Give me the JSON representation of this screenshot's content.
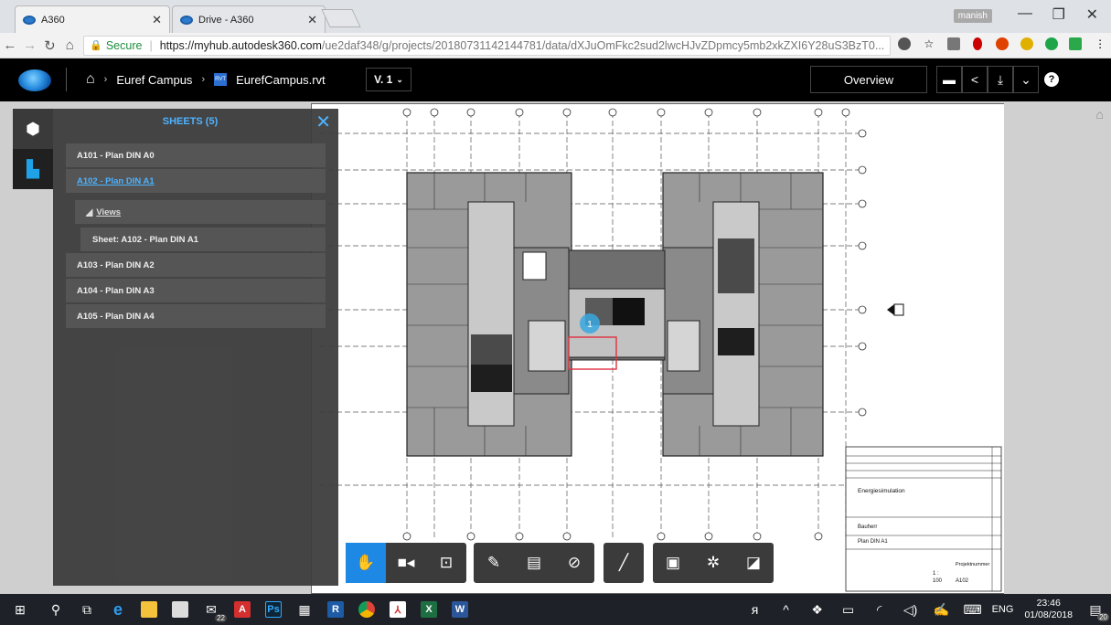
{
  "browser": {
    "tabs": [
      {
        "title": "A360",
        "active": true
      },
      {
        "title": "Drive - A360",
        "active": false
      }
    ],
    "user_badge": "manish",
    "address": {
      "secure_label": "Secure",
      "url_host": "https://myhub.autodesk360.com",
      "url_path": "/ue2daf348/g/projects/20180731142144781/data/dXJuOmFkc2sud2lwcHJvZDpmcy5mb2xkZXI6Y28uS3BzT0..."
    }
  },
  "app": {
    "breadcrumbs": [
      "Euref Campus",
      "EurefCampus.rvt"
    ],
    "version_label": "V. 1",
    "overview_label": "Overview"
  },
  "sheets_panel": {
    "title": "SHEETS (5)",
    "items": [
      {
        "label": "A101 - Plan DIN A0",
        "selected": false
      },
      {
        "label": "A102 - Plan DIN A1",
        "selected": true
      },
      {
        "label": "Views",
        "kind": "group"
      },
      {
        "label": "Sheet: A102 - Plan DIN A1",
        "kind": "sub"
      },
      {
        "label": "A103 - Plan DIN A2",
        "selected": false
      },
      {
        "label": "A104 - Plan DIN A3",
        "selected": false
      },
      {
        "label": "A105 - Plan DIN A4",
        "selected": false
      }
    ]
  },
  "drawing": {
    "marker_number": "1",
    "titleblock": {
      "project_name": "Energiesimulation",
      "client": "Bauherr",
      "sheet_name": "Plan DIN A1",
      "project_number": "Projektnummer",
      "scale": "100",
      "scale_prefix": "1 :",
      "sheet_number": "A102"
    }
  },
  "taskbar": {
    "badge_count": "22",
    "language": "ENG",
    "time": "23:46",
    "date": "01/08/2018",
    "notification_count": "20"
  },
  "icons": [
    "home-icon",
    "cube-icon",
    "sheet-icon",
    "pan-icon",
    "camera-icon",
    "zoom-icon",
    "markup-icon",
    "comment-icon",
    "hide-icon",
    "measure-icon",
    "properties-icon",
    "settings-icon",
    "fullscreen-icon"
  ],
  "colors": {
    "accent": "#1e88e5",
    "panel_title": "#4eb3ff",
    "header_bg": "#000000"
  }
}
